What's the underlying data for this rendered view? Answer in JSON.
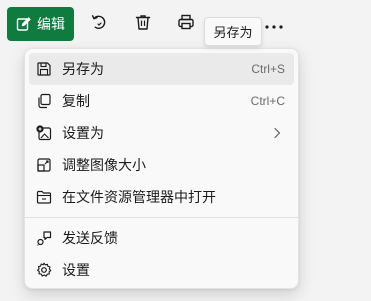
{
  "toolbar": {
    "edit_label": "编辑",
    "accent_color": "#0f7b3f",
    "tools": [
      {
        "icon": "rotate-icon"
      },
      {
        "icon": "delete-icon"
      },
      {
        "icon": "print-icon"
      },
      {
        "icon": "more-icon",
        "glyph": "···"
      }
    ]
  },
  "tooltip": {
    "text": "另存为"
  },
  "menu": {
    "items": [
      {
        "icon": "save-icon",
        "label": "另存为",
        "shortcut": "Ctrl+S",
        "hovered": true
      },
      {
        "icon": "copy-icon",
        "label": "复制",
        "shortcut": "Ctrl+C"
      },
      {
        "icon": "set-as-icon",
        "label": "设置为",
        "submenu": true
      },
      {
        "icon": "resize-image-icon",
        "label": "调整图像大小"
      },
      {
        "icon": "open-folder-icon",
        "label": "在文件资源管理器中打开"
      },
      {
        "separator": true
      },
      {
        "icon": "feedback-icon",
        "label": "发送反馈"
      },
      {
        "icon": "settings-icon",
        "label": "设置"
      }
    ]
  }
}
